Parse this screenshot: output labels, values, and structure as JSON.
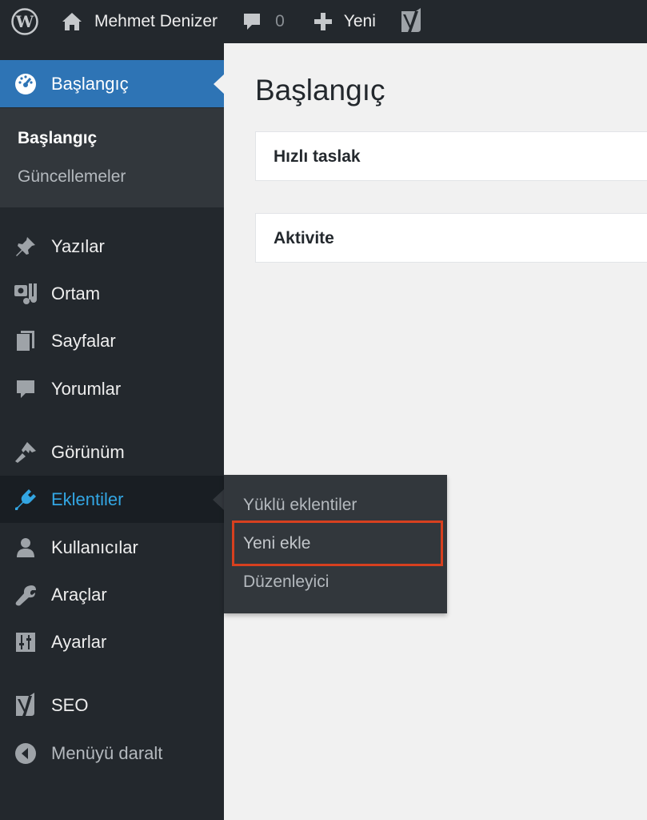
{
  "adminbar": {
    "site_name": "Mehmet Denizer",
    "comment_count": "0",
    "new_label": "Yeni"
  },
  "sidebar": {
    "dashboard": {
      "label": "Başlangıç",
      "submenu": [
        "Başlangıç",
        "Güncellemeler"
      ]
    },
    "items": [
      {
        "label": "Yazılar",
        "icon": "pin-icon"
      },
      {
        "label": "Ortam",
        "icon": "media-icon"
      },
      {
        "label": "Sayfalar",
        "icon": "pages-icon"
      },
      {
        "label": "Yorumlar",
        "icon": "comment-icon"
      },
      {
        "label": "Görünüm",
        "icon": "appearance-icon"
      },
      {
        "label": "Eklentiler",
        "icon": "plugin-icon"
      },
      {
        "label": "Kullanıcılar",
        "icon": "user-icon"
      },
      {
        "label": "Araçlar",
        "icon": "wrench-icon"
      },
      {
        "label": "Ayarlar",
        "icon": "settings-icon"
      },
      {
        "label": "SEO",
        "icon": "yoast-icon"
      },
      {
        "label": "Menüyü daralt",
        "icon": "collapse-icon"
      }
    ]
  },
  "flyout": {
    "items": [
      "Yüklü eklentiler",
      "Yeni ekle",
      "Düzenleyici"
    ]
  },
  "main": {
    "title": "Başlangıç",
    "boxes": [
      "Hızlı taslak",
      "Aktivite"
    ]
  },
  "colors": {
    "adminbar_bg": "#23282d",
    "menu_current": "#2e74b5",
    "menu_hover_text": "#33a6e3",
    "highlight": "#d7401f"
  }
}
